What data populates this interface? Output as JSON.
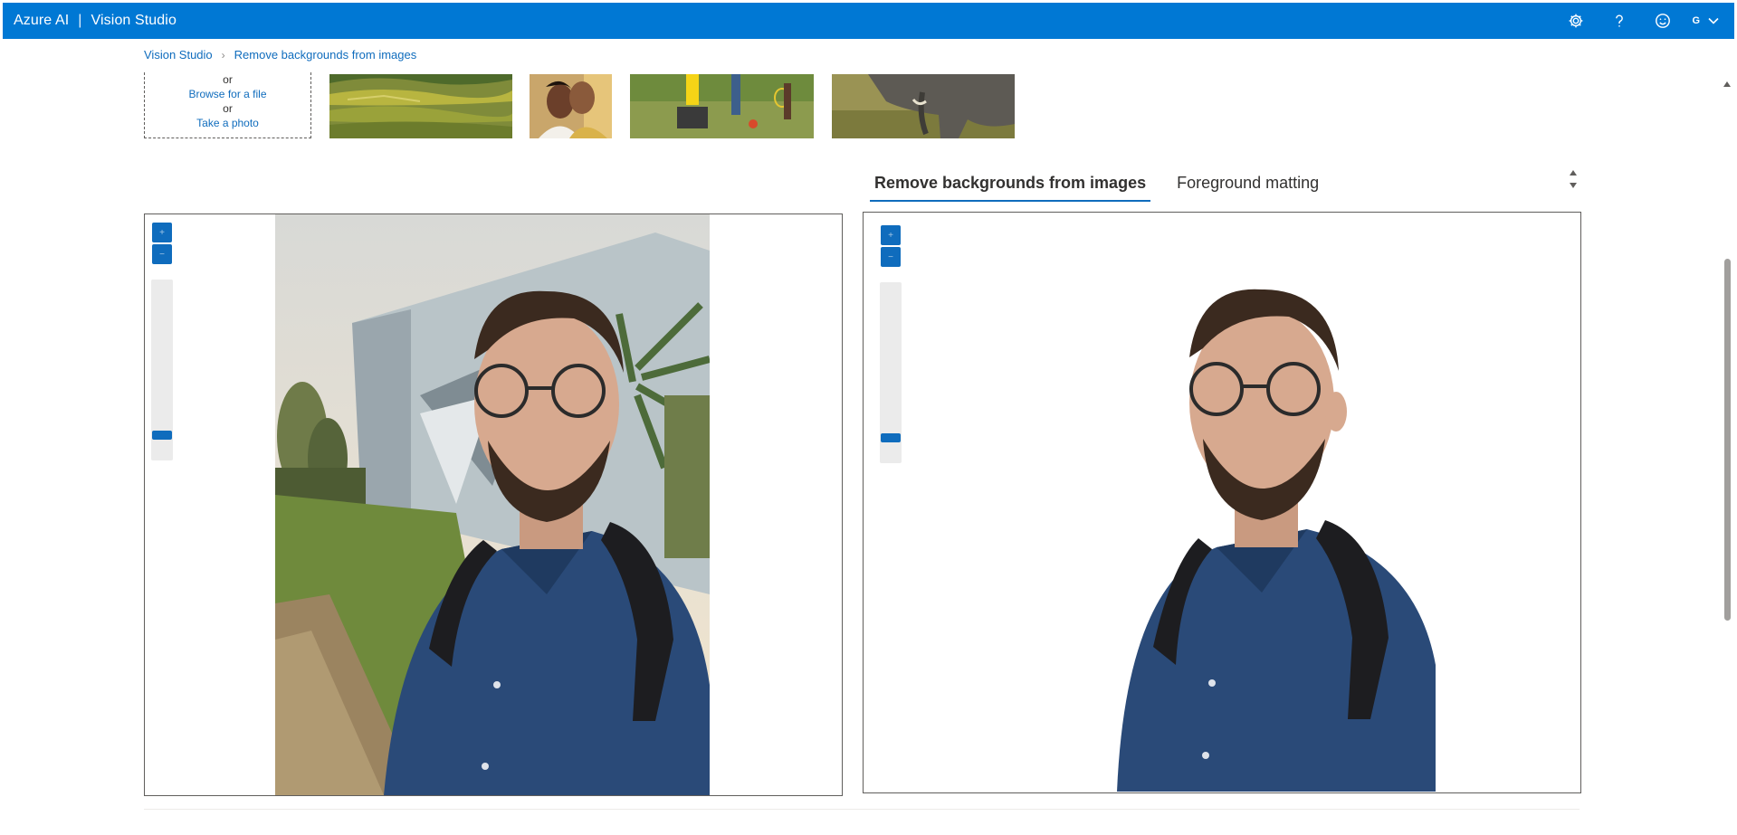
{
  "app": {
    "product": "Azure AI",
    "separator": "|",
    "title": "Vision Studio",
    "brand_color": "#0078d4"
  },
  "header_icons": [
    "settings-icon",
    "help-icon",
    "feedback-smiley-icon",
    "chevron-down-icon"
  ],
  "user": {
    "initial": "G"
  },
  "breadcrumb": {
    "items": [
      "Vision Studio",
      "Remove backgrounds from images"
    ]
  },
  "upload": {
    "or_1": "or",
    "browse": "Browse for a file",
    "or_2": "or",
    "take_photo": "Take a photo"
  },
  "samples": [
    "rice-terraces-landscape",
    "smiling-couple",
    "kids-playing-outdoors",
    "elephant"
  ],
  "tabs": [
    {
      "label": "Remove backgrounds from images",
      "active": true
    },
    {
      "label": "Foreground matting",
      "active": false
    }
  ],
  "viewer": {
    "left": {
      "zoom_in": "+",
      "zoom_out": "−",
      "zoom_level": 0.05
    },
    "right": {
      "zoom_in": "+",
      "zoom_out": "−",
      "zoom_level": 0.05
    }
  }
}
